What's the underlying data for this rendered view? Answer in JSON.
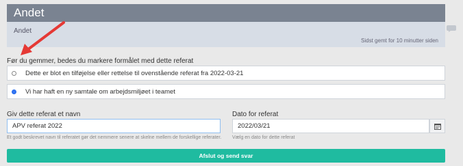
{
  "section": {
    "title": "Andet",
    "body_text": "Andet",
    "saved_text": "Sidst gemt for 10 minutter siden"
  },
  "purpose": {
    "label": "Før du gemmer, bedes du markere formålet med dette referat",
    "options": [
      {
        "label": "Dette er blot en tilføjelse eller rettelse til ovenstående referat fra 2022-03-21",
        "selected": false
      },
      {
        "label": "Vi har haft en ny samtale om arbejdsmiljøet i teamet",
        "selected": true
      }
    ]
  },
  "name_field": {
    "label": "Giv dette referat et navn",
    "value": "APV referat 2022",
    "help": "Et godt beskrevet navn til referatet gør det nemmere senere at skelne mellem de forskellige referater."
  },
  "date_field": {
    "label": "Dato for referat",
    "value": "2022/03/21",
    "help": "Vælg en dato for dette referat"
  },
  "submit_label": "Afslut og send svar",
  "colors": {
    "header_bg": "#7a8391",
    "panel_bg": "#d7dde6",
    "submit_bg": "#1fbba0",
    "radio_accent": "#2a6ef0",
    "annotation_arrow": "#e53935"
  },
  "icons": {
    "chat": "chat-bubble-icon",
    "calendar": "calendar-icon",
    "annotation": "arrow-annotation"
  }
}
